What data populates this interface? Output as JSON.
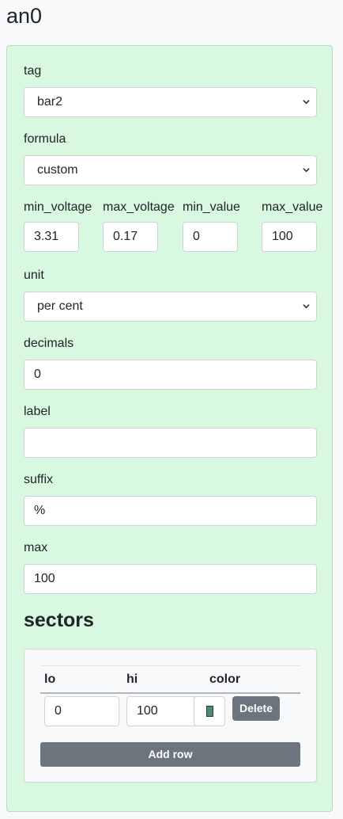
{
  "page": {
    "title": "an0"
  },
  "form": {
    "tag": {
      "label": "tag",
      "value": "bar2"
    },
    "formula": {
      "label": "formula",
      "value": "custom"
    },
    "min_voltage": {
      "label": "min_voltage",
      "value": "3.31"
    },
    "max_voltage": {
      "label": "max_voltage",
      "value": "0.17"
    },
    "min_value": {
      "label": "min_value",
      "value": "0"
    },
    "max_value": {
      "label": "max_value",
      "value": "100"
    },
    "unit": {
      "label": "unit",
      "value": "per cent"
    },
    "decimals": {
      "label": "decimals",
      "value": "0"
    },
    "label": {
      "label": "label",
      "value": ""
    },
    "suffix": {
      "label": "suffix",
      "value": "%"
    },
    "max": {
      "label": "max",
      "value": "100"
    }
  },
  "sectors": {
    "heading": "sectors",
    "columns": [
      "lo",
      "hi",
      "color"
    ],
    "rows": [
      {
        "lo": "0",
        "hi": "100",
        "color": "#4a8b7d"
      }
    ],
    "delete_label": "Delete",
    "add_row_label": "Add row"
  },
  "colors": {
    "panel_background": "#d8f8df",
    "button_gray": "#6c757d"
  },
  "icons": {
    "select_chevron": "chevron-down-icon"
  }
}
